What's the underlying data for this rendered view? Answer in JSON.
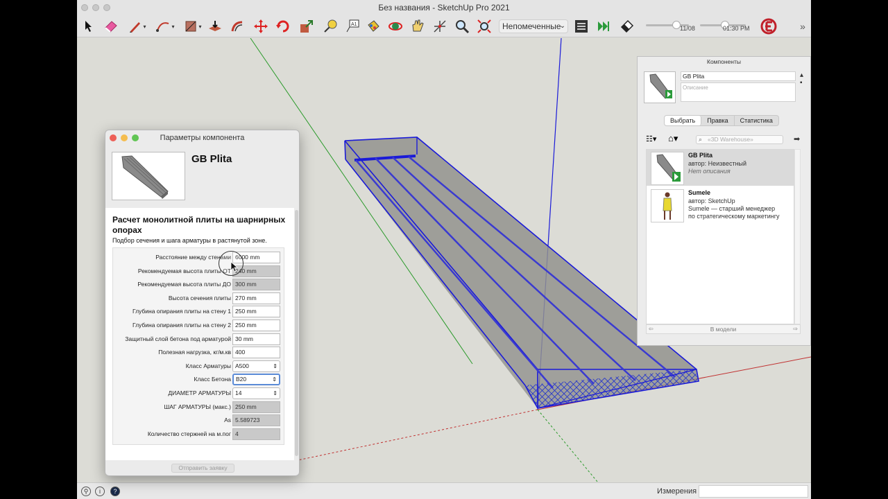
{
  "window": {
    "title": "Без названия - SketchUp Pro 2021"
  },
  "toolbar": {
    "tools": [
      {
        "icon": "select-arrow-icon"
      },
      {
        "icon": "eraser-icon"
      },
      {
        "icon": "pencil-line-icon"
      },
      {
        "icon": "arc-icon"
      },
      {
        "icon": "rectangle-icon"
      },
      {
        "icon": "push-pull-icon"
      },
      {
        "icon": "offset-icon"
      },
      {
        "icon": "move-icon"
      },
      {
        "icon": "rotate-icon"
      },
      {
        "icon": "scale-icon"
      },
      {
        "icon": "tape-measure-icon"
      },
      {
        "icon": "text-label-icon"
      },
      {
        "icon": "paint-bucket-icon"
      },
      {
        "icon": "orbit-icon"
      },
      {
        "icon": "pan-icon"
      },
      {
        "icon": "position-camera-icon"
      },
      {
        "icon": "zoom-icon"
      },
      {
        "icon": "zoom-extents-icon"
      }
    ],
    "style_select": "Непомеченные",
    "shadow_date": "11/08",
    "shadow_time": "01:30 PM",
    "shadow_date_level": 0.75,
    "shadow_time_level": 0.55
  },
  "status": {
    "measure_label": "Измерения",
    "measure_value": ""
  },
  "params": {
    "title": "Параметры компонента",
    "component_name": "GB Plita",
    "heading": "Расчет монолитной плиты на шарнирных опорах",
    "subheading": "Подбор сечения и шага арматуры в растянутой зоне.",
    "fields": [
      {
        "label": "Расстояние между стенами",
        "value": "6000 mm",
        "kind": "input"
      },
      {
        "label": "Рекомендуемая высота плиты ОТ",
        "value": "240 mm",
        "kind": "readonly"
      },
      {
        "label": "Рекомендуемая высота плиты ДО",
        "value": "300 mm",
        "kind": "readonly"
      },
      {
        "label": "Высота сечения плиты",
        "value": "270 mm",
        "kind": "input"
      },
      {
        "label": "Глубина опирания плиты на стену 1",
        "value": "250 mm",
        "kind": "input"
      },
      {
        "label": "Глубина опирания плиты на стену 2",
        "value": "250 mm",
        "kind": "input"
      },
      {
        "label": "Защитный слой бетона под арматурой",
        "value": "30 mm",
        "kind": "input"
      },
      {
        "label": "Полезная нагрузка, кг/м.кв",
        "value": "400",
        "kind": "input"
      },
      {
        "label": "Класс Арматуры",
        "value": "A500",
        "kind": "select"
      },
      {
        "label": "Класс Бетона",
        "value": "B20",
        "kind": "select-focus"
      },
      {
        "label": "ДИАМЕТР АРМАТУРЫ",
        "value": "14",
        "kind": "select"
      },
      {
        "label": "ШАГ АРМАТУРЫ (макс.)",
        "value": "250 mm",
        "kind": "readonly"
      },
      {
        "label": "As",
        "value": "5.589723",
        "kind": "readonly"
      },
      {
        "label": "Количество стержней на м.пог",
        "value": "4",
        "kind": "readonly"
      }
    ],
    "send_button": "Отправить заявку"
  },
  "components": {
    "title": "Компоненты",
    "name_value": "GB Plita",
    "description_placeholder": "Описание",
    "tabs": [
      {
        "label": "Выбрать",
        "active": true
      },
      {
        "label": "Правка",
        "active": false
      },
      {
        "label": "Статистика",
        "active": false
      }
    ],
    "search_placeholder": "«3D Warehouse»",
    "items": [
      {
        "title": "GB Plita",
        "author": "автор: Неизвестный",
        "desc1": "Нет описания",
        "desc2": ""
      },
      {
        "title": "Sumele",
        "author": "автор: SketchUp",
        "desc1": "Sumele — старший менеджер",
        "desc2": "по стратегическому маркетингу"
      }
    ],
    "footer": "В модели"
  }
}
